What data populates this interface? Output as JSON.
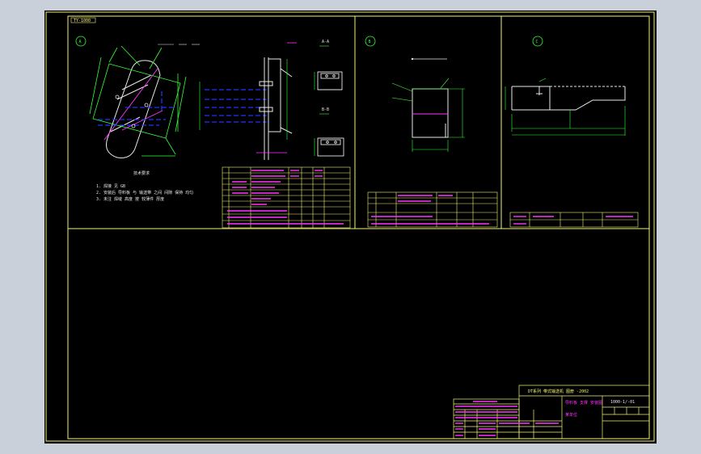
{
  "title_block": {
    "project": "DT系列 带式输送机 图册 -2002",
    "part_name": "导料板 支撑 安装图",
    "org": "某单位",
    "drawing_no": "1000-1/-01"
  },
  "sheet_code": "TY-1000",
  "views": {
    "a": "A",
    "b": "B",
    "c": "C"
  },
  "section_labels": [
    "A-A",
    "B-B"
  ],
  "technical_notes": {
    "heading": "技术要求",
    "lines": [
      "1. 焊接 见 GB",
      "2. 安装后 导料板 与 输送带 之间 间隙 保持 均匀",
      "3. 未注 焊缝 高度 按 较薄件 厚度"
    ]
  },
  "colors": {
    "paper": "#c9d0d9",
    "sheet": "#000000",
    "frame": "#f2f27a",
    "geometry": "#e8e8e8",
    "dimension": "#33ff33",
    "hidden": "#2233ff",
    "text": "#ff33ff"
  }
}
